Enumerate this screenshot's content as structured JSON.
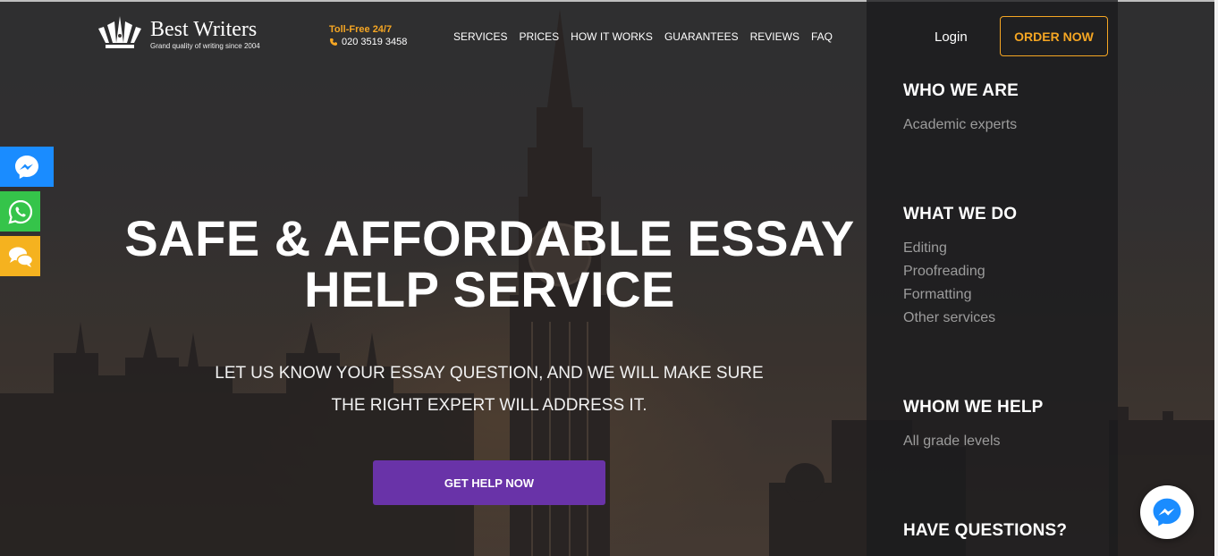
{
  "brand": {
    "name": "Best Writers",
    "tagline": "Grand quality of writing since 2004",
    "icon": "crown-pen-logo"
  },
  "contact": {
    "tollfree_label": "Toll-Free 24/7",
    "phone": "020 3519 3458",
    "icon": "phone-icon"
  },
  "nav": {
    "items": [
      "SERVICES",
      "PRICES",
      "HOW IT WORKS",
      "GUARANTEES",
      "REVIEWS",
      "FAQ"
    ]
  },
  "header_actions": {
    "login": "Login",
    "order": "ORDER NOW"
  },
  "hero": {
    "title_line1": "SAFE & AFFORDABLE ESSAY",
    "title_line2": "HELP SERVICE",
    "sub_line1": "LET US KNOW YOUR ESSAY QUESTION, AND WE WILL MAKE SURE",
    "sub_line2": "THE RIGHT EXPERT WILL ADDRESS IT.",
    "cta": "GET HELP NOW"
  },
  "side_panel": {
    "sections": [
      {
        "heading": "WHO WE ARE",
        "links": [
          "Academic experts"
        ]
      },
      {
        "heading": "WHAT WE DO",
        "links": [
          "Editing",
          "Proofreading",
          "Formatting",
          "Other services"
        ]
      },
      {
        "heading": "WHOM WE HELP",
        "links": [
          "All grade levels"
        ]
      },
      {
        "heading": "HAVE QUESTIONS?",
        "links": []
      }
    ]
  },
  "social": {
    "items": [
      "messenger-icon",
      "whatsapp-icon",
      "chat-bubbles-icon"
    ]
  },
  "colors": {
    "accent_orange": "#f5a623",
    "cta_purple": "#6933a8",
    "messenger_blue": "#1a8cff",
    "whatsapp_green": "#35c44a",
    "chat_yellow": "#f5b21f",
    "panel_link_gray": "#9c9c9c"
  }
}
